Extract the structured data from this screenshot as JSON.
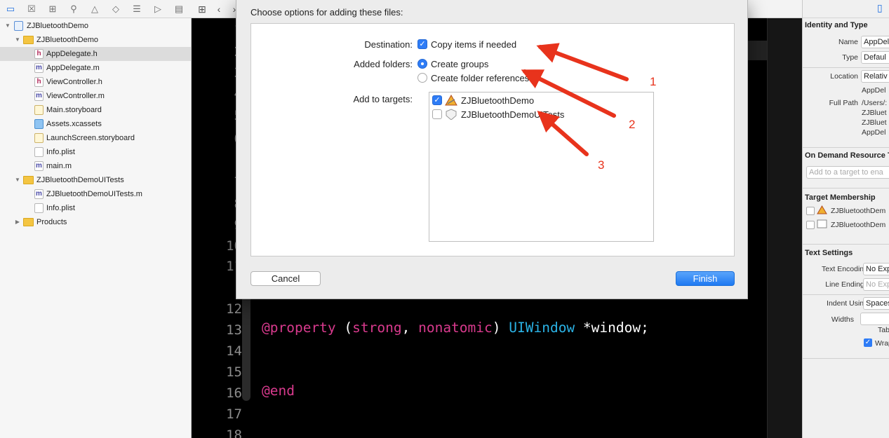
{
  "navigator": {
    "items": [
      {
        "label": "ZJBluetoothDemo",
        "type": "project"
      },
      {
        "label": "ZJBluetoothDemo",
        "type": "folder"
      },
      {
        "label": "AppDelegate.h",
        "type": "h"
      },
      {
        "label": "AppDelegate.m",
        "type": "m"
      },
      {
        "label": "ViewController.h",
        "type": "h"
      },
      {
        "label": "ViewController.m",
        "type": "m"
      },
      {
        "label": "Main.storyboard",
        "type": "storyboard"
      },
      {
        "label": "Assets.xcassets",
        "type": "xcassets"
      },
      {
        "label": "LaunchScreen.storyboard",
        "type": "storyboard"
      },
      {
        "label": "Info.plist",
        "type": "plist"
      },
      {
        "label": "main.m",
        "type": "m"
      },
      {
        "label": "ZJBluetoothDemoUITests",
        "type": "folder"
      },
      {
        "label": "ZJBluetoothDemoUITests.m",
        "type": "m"
      },
      {
        "label": "Info.plist",
        "type": "plist"
      },
      {
        "label": "Products",
        "type": "folder"
      }
    ],
    "file_letters": {
      "h": "h",
      "m": "m"
    }
  },
  "editor": {
    "line_numbers": [
      "1",
      "2",
      "3",
      "4",
      "5",
      "6",
      "7",
      "8",
      "9",
      "10",
      "11",
      "12",
      "13",
      "14",
      "15",
      "16",
      "17",
      "18"
    ],
    "code_line_13": {
      "at": "@property",
      "open": " (",
      "strong": "strong",
      "comma": ", ",
      "nonatomic": "nonatomic",
      "close": ") ",
      "type": "UIWindow",
      "rest": " *window;"
    },
    "code_line_16": "@end"
  },
  "dialog": {
    "title": "Choose options for adding these files:",
    "destination_label": "Destination:",
    "copy_items_label": "Copy items if needed",
    "copy_items_checked": true,
    "added_folders_label": "Added folders:",
    "create_groups_label": "Create groups",
    "create_folder_refs_label": "Create folder references",
    "add_to_targets_label": "Add to targets:",
    "targets": [
      {
        "name": "ZJBluetoothDemo",
        "checked": true
      },
      {
        "name": "ZJBluetoothDemoUITests",
        "checked": false
      }
    ],
    "cancel_label": "Cancel",
    "finish_label": "Finish",
    "check_glyph": "✓"
  },
  "inspector": {
    "identity_title": "Identity and Type",
    "name_label": "Name",
    "name_value": "AppDel",
    "type_label": "Type",
    "type_value": "Defaul",
    "location_label": "Location",
    "location_value": "Relativ",
    "location_file": "AppDel",
    "full_path_label": "Full Path",
    "full_path_lines": [
      "/Users/:",
      "ZJBluet",
      "ZJBluet",
      "AppDel"
    ],
    "odr_title": "On Demand Resource Ta",
    "odr_placeholder": "Add to a target to ena",
    "target_membership_title": "Target Membership",
    "targets": [
      "ZJBluetoothDem",
      "ZJBluetoothDem"
    ],
    "text_settings_title": "Text Settings",
    "text_encoding_label": "Text Encoding",
    "text_encoding_value": "No Exp",
    "line_endings_label": "Line Endings",
    "line_endings_value": "No Exp",
    "indent_using_label": "Indent Using",
    "indent_using_value": "Spaces",
    "widths_label": "Widths",
    "tab_label": "Tab",
    "wrap_label": "Wrap"
  },
  "annotations": [
    "1",
    "2",
    "3"
  ],
  "colors": {
    "arrow": "#e8331c",
    "accent": "#2e7cf6",
    "keyword": "#d83a8d",
    "type": "#2bb3e6"
  }
}
